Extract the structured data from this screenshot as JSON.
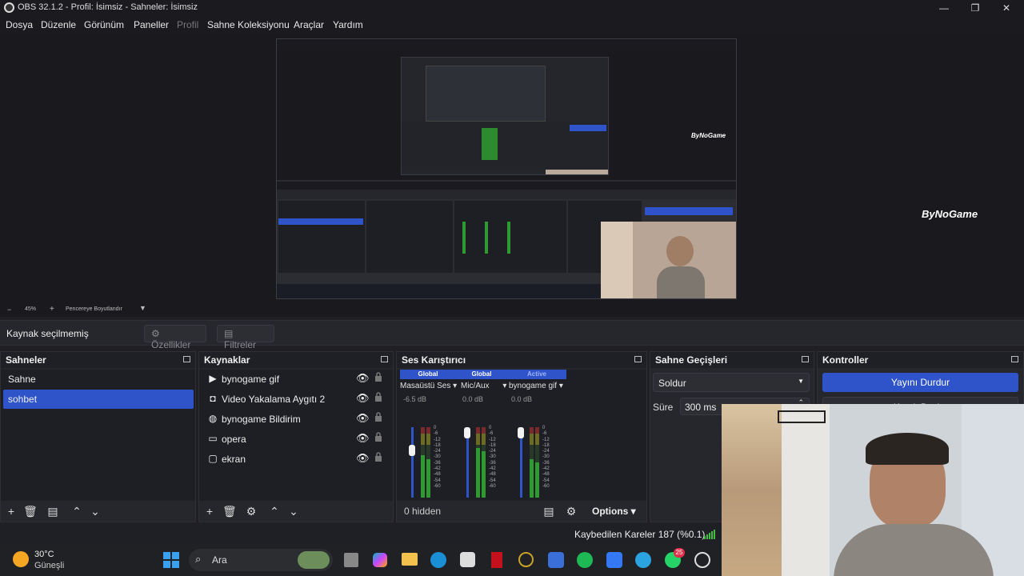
{
  "window": {
    "title": "OBS 32.1.2 - Profil: İsimsiz - Sahneler: İsimsiz"
  },
  "menu": {
    "items": [
      "Dosya",
      "Düzenle",
      "Görünüm",
      "Paneller",
      "Profil",
      "Sahne Koleksiyonu",
      "Araçlar",
      "Yardım"
    ]
  },
  "preview": {
    "brand": "ByNoGame",
    "nested_brand": "ByNoGame"
  },
  "zoombar": {
    "minus": "−",
    "zoom": "45%",
    "plus": "+",
    "fit_label": "Pencereye Boyutlandır"
  },
  "context": {
    "no_source": "Kaynak seçilmemiş",
    "properties": "Özellikler",
    "filters": "Filtreler"
  },
  "scenes": {
    "title": "Sahneler",
    "items": [
      "Sahne",
      "sohbet"
    ],
    "selected": "sohbet"
  },
  "sources": {
    "title": "Kaynaklar",
    "items": [
      {
        "label": "bynogame gif",
        "icon": "play-icon"
      },
      {
        "label": "Video Yakalama Aygıtı 2",
        "icon": "camera-icon"
      },
      {
        "label": "bynogame Bildirim",
        "icon": "globe-icon"
      },
      {
        "label": "opera",
        "icon": "window-icon"
      },
      {
        "label": "ekran",
        "icon": "monitor-icon"
      }
    ]
  },
  "mixer": {
    "title": "Ses Karıştırıcı",
    "channels": [
      {
        "head": "Global",
        "name": "Masaüstü Ses",
        "db": "-6.5 dB",
        "level": 0.55,
        "color": "#2f54c9"
      },
      {
        "head": "Global",
        "name": "Mic/Aux",
        "db": "0.0 dB",
        "level": 0.7,
        "color": "#2f54c9"
      },
      {
        "head": "Active",
        "name": "bynogame gif",
        "db": "0.0 dB",
        "level": 0.55,
        "color": "#2f54c9"
      }
    ],
    "ticks": [
      "0",
      "-6",
      "-12",
      "-18",
      "-24",
      "-30",
      "-36",
      "-42",
      "-48",
      "-54",
      "-60"
    ],
    "hidden": "0 hidden",
    "options": "Options"
  },
  "transitions": {
    "title": "Sahne Geçişleri",
    "selected": "Soldur",
    "duration_label": "Süre",
    "duration_value": "300 ms"
  },
  "controls": {
    "title": "Kontroller",
    "stop_stream": "Yayını Durdur",
    "record": "Kaydı Başlat"
  },
  "status": {
    "dropped_frames": "Kaybedilen Kareler 187 (%0.1)"
  },
  "taskbar": {
    "weather_temp": "30°C",
    "weather_desc": "Güneşli",
    "search": "Ara",
    "badge": "25"
  },
  "colors": {
    "accent": "#2f54c9",
    "panel_bg": "#26272c",
    "list_bg": "#1e1f24"
  }
}
